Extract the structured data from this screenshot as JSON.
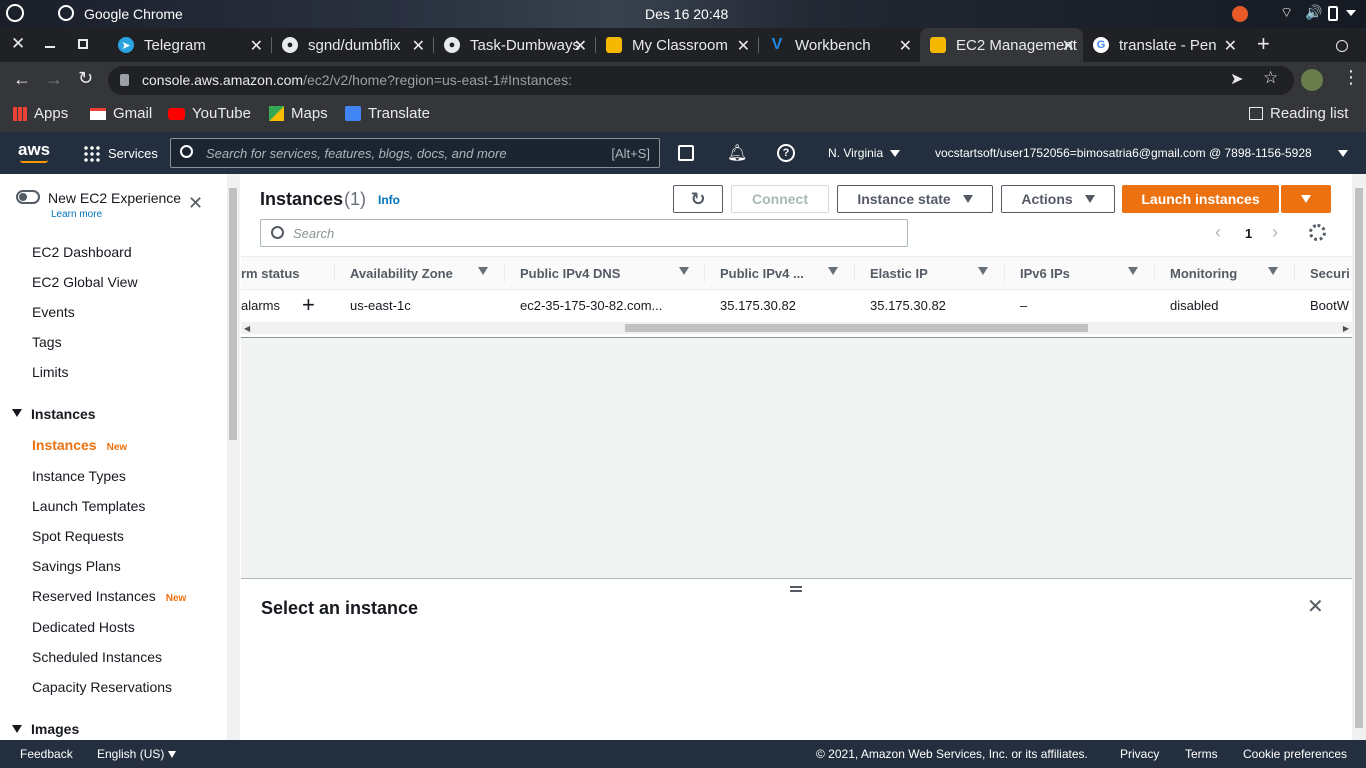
{
  "os": {
    "app_name": "Google Chrome",
    "datetime": "Des 16  20:48"
  },
  "tabs": [
    {
      "label": "Telegram",
      "color": "#2aa3df",
      "icon": "telegram-icon"
    },
    {
      "label": "sgnd/dumbflix",
      "color": "#3c3c3c",
      "icon": "github-icon"
    },
    {
      "label": "Task-Dumbways",
      "color": "#3c3c3c",
      "icon": "github-icon"
    },
    {
      "label": "My Classroom",
      "color": "#f5b800",
      "icon": "box-icon"
    },
    {
      "label": "Workbench",
      "color": "#1e88e5",
      "icon": "workbench-icon"
    },
    {
      "label": "EC2 Management",
      "color": "#f5b800",
      "icon": "box-icon"
    },
    {
      "label": "translate - Pen",
      "color": "#4285f4",
      "icon": "google-icon"
    }
  ],
  "address": {
    "domain": "console.aws.amazon.com",
    "path": "/ec2/v2/home?region=us-east-1#Instances:"
  },
  "bookmarks": {
    "apps": "Apps",
    "gmail": "Gmail",
    "youtube": "YouTube",
    "maps": "Maps",
    "translate": "Translate",
    "reading_list": "Reading list"
  },
  "aws": {
    "logo": "aws",
    "services": "Services",
    "search_placeholder": "Search for services, features, blogs, docs, and more",
    "search_shortcut": "[Alt+S]",
    "region": "N. Virginia",
    "account": "vocstartsoft/user1752056=bimosatria6@gmail.com @ 7898-1156-5928"
  },
  "sidebar": {
    "toggle_label": "New EC2 Experience",
    "learn_more": "Learn more",
    "items": [
      "EC2 Dashboard",
      "EC2 Global View",
      "Events",
      "Tags",
      "Limits"
    ],
    "section_instances": "Instances",
    "instances_items": [
      {
        "label": "Instances",
        "badge": "New"
      },
      {
        "label": "Instance Types",
        "badge": ""
      },
      {
        "label": "Launch Templates",
        "badge": ""
      },
      {
        "label": "Spot Requests",
        "badge": ""
      },
      {
        "label": "Savings Plans",
        "badge": ""
      },
      {
        "label": "Reserved Instances",
        "badge": "New"
      },
      {
        "label": "Dedicated Hosts",
        "badge": ""
      },
      {
        "label": "Scheduled Instances",
        "badge": ""
      },
      {
        "label": "Capacity Reservations",
        "badge": ""
      }
    ],
    "section_images": "Images"
  },
  "main": {
    "title": "Instances",
    "count": "(1)",
    "info": "Info",
    "connect": "Connect",
    "instance_state": "Instance state",
    "actions": "Actions",
    "launch": "Launch instances",
    "search_placeholder": "Search",
    "page": "1",
    "columns": [
      "rm status",
      "Availability Zone",
      "Public IPv4 DNS",
      "Public IPv4 ...",
      "Elastic IP",
      "IPv6 IPs",
      "Monitoring",
      "Securi"
    ],
    "row": [
      "alarms",
      "us-east-1c",
      "ec2-35-175-30-82.com...",
      "35.175.30.82",
      "35.175.30.82",
      "–",
      "disabled",
      "BootW"
    ]
  },
  "bottom": {
    "title": "Select an instance"
  },
  "footer": {
    "feedback": "Feedback",
    "language": "English (US)",
    "copyright": "© 2021, Amazon Web Services, Inc. or its affiliates.",
    "privacy": "Privacy",
    "terms": "Terms",
    "cookies": "Cookie preferences"
  }
}
